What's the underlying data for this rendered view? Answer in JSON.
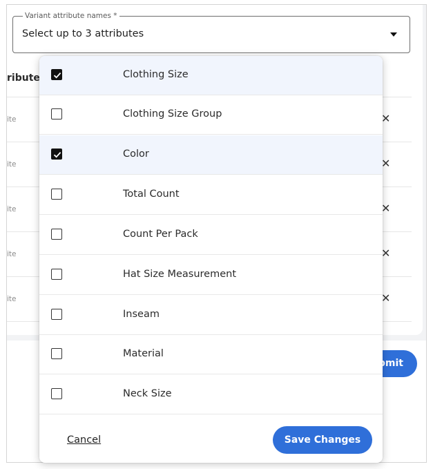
{
  "attribute_select": {
    "legend": "Variant attribute names *",
    "value": "Select up to 3 attributes"
  },
  "background": {
    "column_header": "ribute",
    "rows": [
      {
        "text": "ite",
        "remove_icon": "✕"
      },
      {
        "text": "ite",
        "remove_icon": "✕"
      },
      {
        "text": "ite",
        "remove_icon": "✕"
      },
      {
        "text": "ite",
        "remove_icon": "✕"
      },
      {
        "text": "ite",
        "remove_icon": "✕"
      }
    ],
    "submit_label": "bmit"
  },
  "options": [
    {
      "label": "Clothing Size",
      "checked": true
    },
    {
      "label": "Clothing Size Group",
      "checked": false
    },
    {
      "label": "Color",
      "checked": true
    },
    {
      "label": "Total Count",
      "checked": false
    },
    {
      "label": "Count Per Pack",
      "checked": false
    },
    {
      "label": "Hat Size Measurement",
      "checked": false
    },
    {
      "label": "Inseam",
      "checked": false
    },
    {
      "label": "Material",
      "checked": false
    },
    {
      "label": "Neck Size",
      "checked": false
    }
  ],
  "footer": {
    "cancel_label": "Cancel",
    "save_label": "Save Changes"
  },
  "colors": {
    "accent": "#2f6fd9",
    "checked_row": "#f1f5fd"
  }
}
